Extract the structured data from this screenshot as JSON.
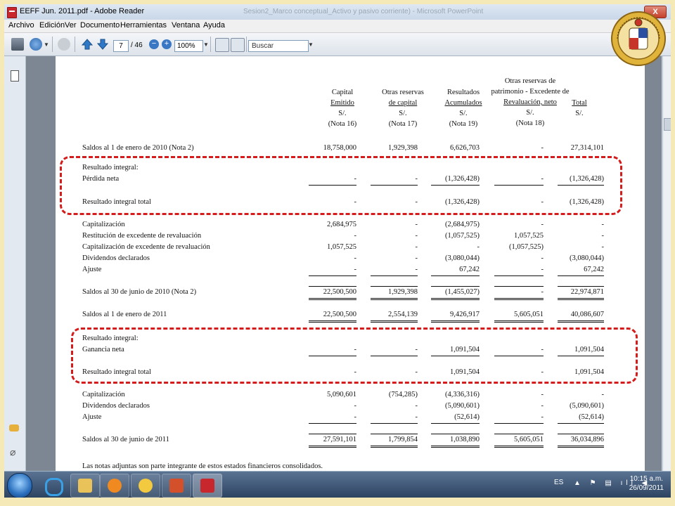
{
  "window": {
    "title": "EEFF Jun. 2011.pdf - Adobe Reader",
    "background_title": "Sesion2_Marco conceptual_Activo y pasivo corriente) - Microsoft PowerPoint",
    "close_label": "X"
  },
  "menu": [
    "Archivo",
    "Edición",
    "Ver",
    "Documento",
    "Herramientas",
    "Ventana",
    "Ayuda"
  ],
  "toolbar": {
    "page_current": "7",
    "page_total": "/ 46",
    "zoom": "100%",
    "search_placeholder": "Buscar"
  },
  "table": {
    "columns": [
      {
        "lines": [
          "Capital",
          "Emitido",
          "S/.",
          "(Nota 16)"
        ],
        "underline": [
          1
        ]
      },
      {
        "lines": [
          "Otras reservas",
          "de capital",
          "S/.",
          "(Nota 17)"
        ],
        "underline": [
          1
        ]
      },
      {
        "lines": [
          "Resultados",
          "Acumulados",
          "S/.",
          "(Nota 19)"
        ],
        "underline": [
          1
        ]
      },
      {
        "lines": [
          "Otras reservas de",
          "patrimonio - Excedente de",
          "Revaluación, neto",
          "S/.",
          "(Nota 18)"
        ],
        "underline": [
          2
        ]
      },
      {
        "lines": [
          "Total",
          "S/."
        ],
        "underline": [
          0
        ]
      }
    ],
    "rows": [
      {
        "label": "Saldos al 1 de enero de 2010 (Nota 2)",
        "values": [
          "18,758,000",
          "1,929,398",
          "6,626,703",
          "-",
          "27,314,101"
        ]
      },
      {
        "label": "Resultado integral:",
        "values": []
      },
      {
        "label": "Pérdida neta",
        "values": [
          "-",
          "-",
          "(1,326,428)",
          "-",
          "(1,326,428)"
        ]
      },
      {
        "label": "Resultado integral total",
        "values": [
          "-",
          "-",
          "(1,326,428)",
          "-",
          "(1,326,428)"
        ]
      },
      {
        "label": "Capitalización",
        "values": [
          "2,684,975",
          "-",
          "(2,684,975)",
          "-",
          "-"
        ]
      },
      {
        "label": "Restitución de excedente de revaluación",
        "values": [
          "-",
          "-",
          "(1,057,525)",
          "1,057,525",
          "-"
        ]
      },
      {
        "label": "Capitalización de excedente de revaluación",
        "values": [
          "1,057,525",
          "-",
          "-",
          "(1,057,525)",
          "-"
        ]
      },
      {
        "label": "Dividendos declarados",
        "values": [
          "-",
          "-",
          "(3,080,044)",
          "-",
          "(3,080,044)"
        ]
      },
      {
        "label": "Ajuste",
        "values": [
          "-",
          "-",
          "67,242",
          "-",
          "67,242"
        ]
      },
      {
        "label": "Saldos al 30 de junio de 2010 (Nota 2)",
        "values": [
          "22,500,500",
          "1,929,398",
          "(1,455,027)",
          "-",
          "22,974,871"
        ]
      },
      {
        "label": "Saldos al 1 de enero de 2011",
        "values": [
          "22,500,500",
          "2,554,139",
          "9,426,917",
          "5,605,051",
          "40,086,607"
        ]
      },
      {
        "label": "Resultado integral:",
        "values": []
      },
      {
        "label": "Ganancia neta",
        "values": [
          "-",
          "-",
          "1,091,504",
          "-",
          "1,091,504"
        ]
      },
      {
        "label": "Resultado integral total",
        "values": [
          "-",
          "-",
          "1,091,504",
          "-",
          "1,091,504"
        ]
      },
      {
        "label": "Capitalización",
        "values": [
          "5,090,601",
          "(754,285)",
          "(4,336,316)",
          "-",
          "-"
        ]
      },
      {
        "label": "Dividendos declarados",
        "values": [
          "-",
          "-",
          "(5,090,601)",
          "-",
          "(5,090,601)"
        ]
      },
      {
        "label": "Ajuste",
        "values": [
          "-",
          "-",
          "(52,614)",
          "-",
          "(52,614)"
        ]
      },
      {
        "label": "Saldos al 30 de junio de 2011",
        "values": [
          "27,591,101",
          "1,799,854",
          "1,038,890",
          "5,605,051",
          "36,034,896"
        ]
      }
    ],
    "footnote": "Las notas adjuntas son parte integrante de estos estados financieros consolidados."
  },
  "taskbar": {
    "language": "ES",
    "time": "10:15 a.m.",
    "date": "26/09/2011"
  },
  "colors": {
    "highlight_dashes": "#d41c1c",
    "slide_background": "#f6e9b8"
  }
}
